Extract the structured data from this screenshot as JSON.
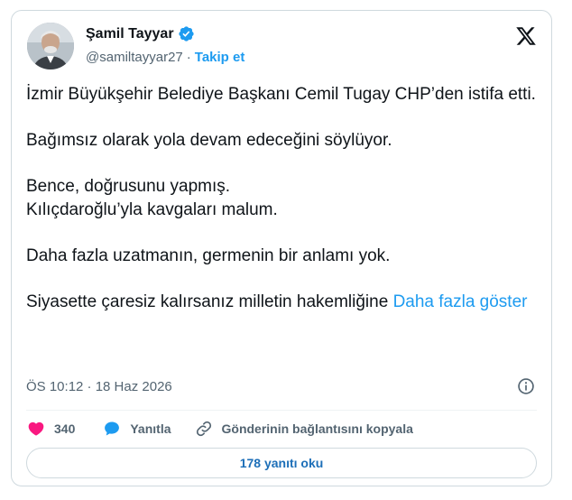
{
  "author": {
    "name": "Şamil Tayyar",
    "handle": "@samiltayyar27",
    "separator": "·",
    "follow_label": "Takip et"
  },
  "tweet": {
    "paragraphs": [
      "İzmir Büyükşehir Belediye Başkanı Cemil Tugay CHP’den istifa etti.",
      "Bağımsız olarak yola devam edeceğini söylüyor.",
      "Bence, doğrusunu yapmış.",
      "Kılıçdaroğlu’yla kavgaları malum.",
      "Daha fazla uzatmanın, germenin bir anlamı yok.",
      "Siyasette çaresiz kalırsanız milletin hakemliğine"
    ],
    "show_more": "Daha fazla göster",
    "timestamp": "ÖS 10:12 · 18 Haz 2026"
  },
  "actions": {
    "like_count": "340",
    "reply_label": "Yanıtla",
    "copy_link_label": "Gönderinin bağlantısını kopyala"
  },
  "read_replies_label": "178 yanıtı oku",
  "icons": {
    "verified": "verified-badge-icon",
    "x_logo": "x-logo-icon",
    "info": "info-icon",
    "heart": "heart-icon",
    "reply": "reply-bubble-icon",
    "link": "link-icon"
  },
  "colors": {
    "accent": "#1d9bf0",
    "like": "#f91880",
    "muted": "#536471",
    "text": "#0f1419",
    "border": "#cfd9de"
  }
}
